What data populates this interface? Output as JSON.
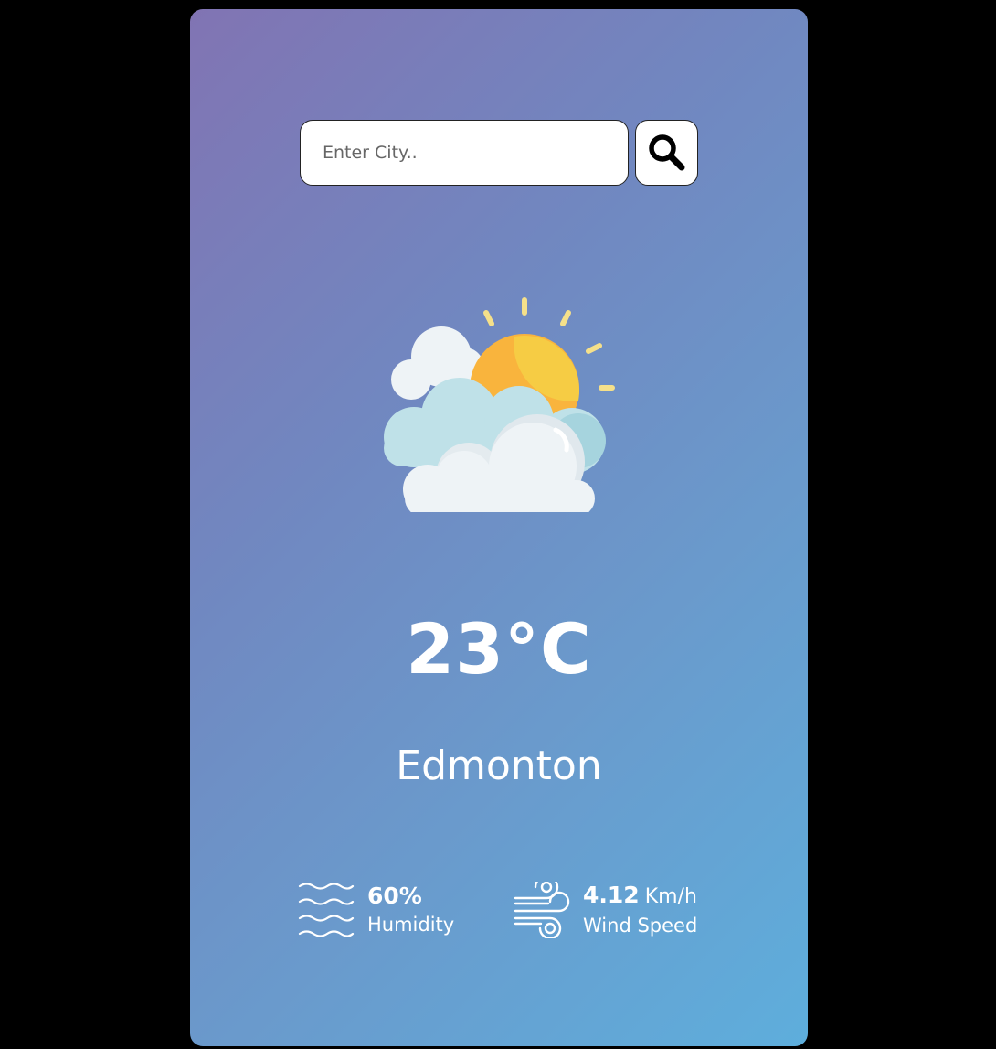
{
  "search": {
    "placeholder": "Enter City..",
    "value": ""
  },
  "weather": {
    "icon": "partly-cloudy-sun-icon",
    "temperature": "23°C",
    "city": "Edmonton"
  },
  "details": {
    "humidity": {
      "icon": "humidity-waves-icon",
      "value": "60%",
      "label": "Humidity"
    },
    "wind": {
      "icon": "wind-icon",
      "value": "4.12",
      "unit": "Km/h",
      "label": "Wind Speed"
    }
  },
  "colors": {
    "page_background": "#000000",
    "card_gradient_start": "#8174b3",
    "card_gradient_end": "#5eaedc",
    "text": "#ffffff",
    "sun": "#f9b43d",
    "sun_rays": "#f5e08a",
    "cloud": "#eef3f6",
    "cloud_back": "#a9d6df"
  }
}
